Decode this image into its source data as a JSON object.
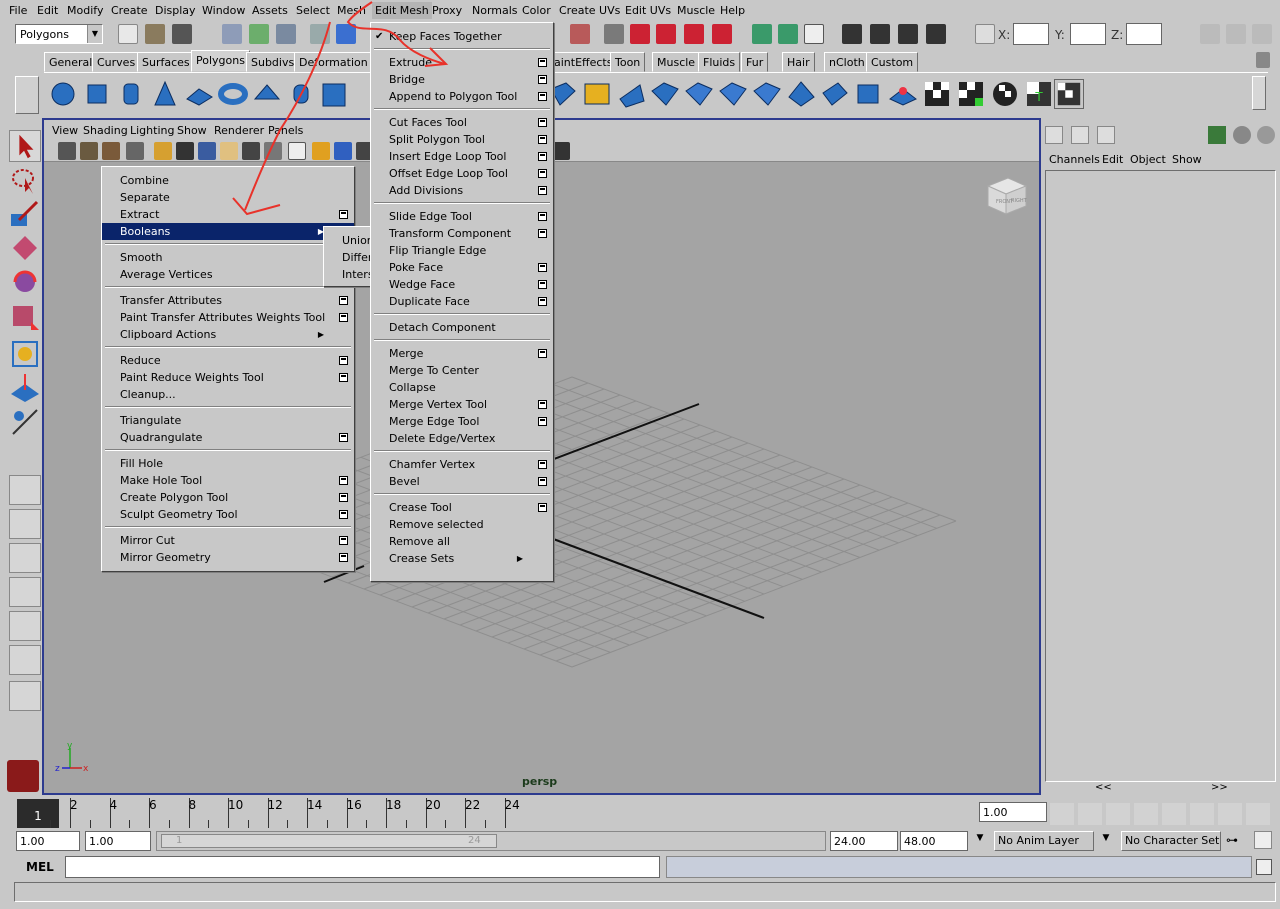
{
  "menubar": {
    "items": [
      "File",
      "Edit",
      "Modify",
      "Create",
      "Display",
      "Window",
      "Assets",
      "Select",
      "Mesh",
      "Edit Mesh",
      "Proxy",
      "Normals",
      "Color",
      "Create UVs",
      "Edit UVs",
      "Muscle",
      "Help"
    ],
    "active": "Edit Mesh"
  },
  "statusline": {
    "mode": "Polygons",
    "x_label": "X:",
    "y_label": "Y:",
    "z_label": "Z:"
  },
  "shelf": {
    "tabs": [
      "General",
      "Curves",
      "Surfaces",
      "Polygons",
      "Subdivs",
      "Deformation",
      "aintEffects",
      "Toon",
      "Muscle",
      "Fluids",
      "Fur",
      "Hair",
      "nCloth",
      "Custom"
    ],
    "active_tab": "Polygons"
  },
  "viewport": {
    "menu": [
      "View",
      "Shading",
      "Lighting",
      "Show",
      "Renderer",
      "Panels"
    ],
    "camera": "persp",
    "viewcube_faces": [
      "FRONT",
      "RIGHT"
    ]
  },
  "channelbox": {
    "menu": [
      "Channels",
      "Edit",
      "Object",
      "Show"
    ],
    "scroll_left": "<<",
    "scroll_right": ">>"
  },
  "timeline": {
    "current_frame": "1",
    "ticks": [
      "2",
      "4",
      "6",
      "8",
      "10",
      "12",
      "14",
      "16",
      "18",
      "20",
      "22",
      "24"
    ],
    "current_time": "1.00",
    "range_start": "1.00",
    "playback_start": "1.00",
    "range_slider_start": "1",
    "range_slider_end": "24",
    "playback_end": "24.00",
    "range_end": "48.00",
    "anim_layer": "No Anim Layer",
    "character_set": "No Character Set"
  },
  "command": {
    "label": "MEL"
  },
  "mesh_menu": {
    "items": [
      {
        "label": "Combine",
        "opt": false
      },
      {
        "label": "Separate",
        "opt": false
      },
      {
        "label": "Extract",
        "opt": true
      },
      {
        "label": "Booleans",
        "opt": false,
        "submenu": true,
        "highlighted": true
      },
      {
        "label": "Smooth",
        "opt": true
      },
      {
        "label": "Average Vertices",
        "opt": true
      },
      {
        "label": "Transfer Attributes",
        "opt": true
      },
      {
        "label": "Paint Transfer Attributes Weights Tool",
        "opt": true
      },
      {
        "label": "Clipboard Actions",
        "opt": false,
        "submenu": true
      },
      {
        "label": "Reduce",
        "opt": true
      },
      {
        "label": "Paint Reduce Weights Tool",
        "opt": true
      },
      {
        "label": "Cleanup...",
        "opt": false
      },
      {
        "label": "Triangulate",
        "opt": false
      },
      {
        "label": "Quadrangulate",
        "opt": true
      },
      {
        "label": "Fill Hole",
        "opt": false
      },
      {
        "label": "Make Hole Tool",
        "opt": true
      },
      {
        "label": "Create Polygon Tool",
        "opt": true
      },
      {
        "label": "Sculpt Geometry Tool",
        "opt": true
      },
      {
        "label": "Mirror Cut",
        "opt": true
      },
      {
        "label": "Mirror Geometry",
        "opt": true
      }
    ]
  },
  "booleans_menu": {
    "items": [
      {
        "label": "Union",
        "opt": true
      },
      {
        "label": "Difference",
        "opt": true
      },
      {
        "label": "Intersection",
        "opt": true
      }
    ]
  },
  "edit_mesh_menu": {
    "items": [
      {
        "label": "Keep Faces Together",
        "checked": true,
        "opt": false
      },
      {
        "label": "Extrude",
        "opt": true
      },
      {
        "label": "Bridge",
        "opt": true
      },
      {
        "label": "Append to Polygon Tool",
        "opt": true
      },
      {
        "label": "Cut Faces Tool",
        "opt": true
      },
      {
        "label": "Split Polygon Tool",
        "opt": true
      },
      {
        "label": "Insert Edge Loop Tool",
        "opt": true
      },
      {
        "label": "Offset Edge Loop Tool",
        "opt": true
      },
      {
        "label": "Add Divisions",
        "opt": true
      },
      {
        "label": "Slide Edge Tool",
        "opt": true
      },
      {
        "label": "Transform Component",
        "opt": true
      },
      {
        "label": "Flip Triangle Edge",
        "opt": false
      },
      {
        "label": "Poke Face",
        "opt": true
      },
      {
        "label": "Wedge Face",
        "opt": true
      },
      {
        "label": "Duplicate Face",
        "opt": true
      },
      {
        "label": "Detach Component",
        "opt": false
      },
      {
        "label": "Merge",
        "opt": true
      },
      {
        "label": "Merge To Center",
        "opt": false
      },
      {
        "label": "Collapse",
        "opt": false
      },
      {
        "label": "Merge Vertex Tool",
        "opt": true
      },
      {
        "label": "Merge Edge Tool",
        "opt": true
      },
      {
        "label": "Delete Edge/Vertex",
        "opt": false
      },
      {
        "label": "Chamfer Vertex",
        "opt": true
      },
      {
        "label": "Bevel",
        "opt": true
      },
      {
        "label": "Crease Tool",
        "opt": true
      },
      {
        "label": "Remove selected",
        "opt": false
      },
      {
        "label": "Remove all",
        "opt": false
      },
      {
        "label": "Crease Sets",
        "opt": false,
        "submenu": true
      }
    ]
  },
  "colors": {
    "accent": "#0a246a",
    "viewport_border": "#2d3b8f",
    "annotation": "#e8322a",
    "shelf_icon": "#2a6fc0"
  }
}
